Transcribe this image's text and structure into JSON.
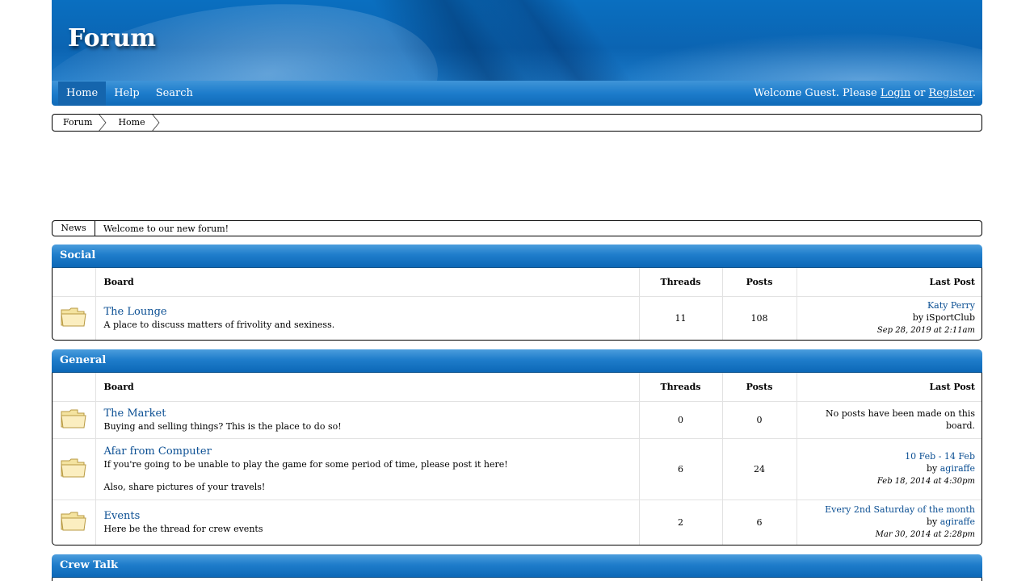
{
  "header": {
    "logo": "Forum"
  },
  "nav": {
    "tabs": [
      "Home",
      "Help",
      "Search"
    ],
    "welcome_prefix": "Welcome Guest. Please ",
    "login": "Login",
    "or": " or ",
    "register": "Register",
    "period": "."
  },
  "breadcrumb": [
    "Forum",
    "Home"
  ],
  "news": {
    "label": "News",
    "text": "Welcome to our new forum!"
  },
  "table_headers": {
    "board": "Board",
    "threads": "Threads",
    "posts": "Posts",
    "last_post": "Last Post"
  },
  "categories": [
    {
      "title": "Social",
      "boards": [
        {
          "name": "The Lounge",
          "desc": "A place to discuss matters of frivolity and sexiness.",
          "threads": "11",
          "posts": "108",
          "last_title": "Katy Perry",
          "last_by": "by iSportClub",
          "last_date": "Sep 28, 2019 at 2:11am"
        }
      ]
    },
    {
      "title": "General",
      "boards": [
        {
          "name": "The Market",
          "desc": "Buying and selling things? This is the place to do so!",
          "threads": "0",
          "posts": "0",
          "last_none": "No posts have been made on this board."
        },
        {
          "name": "Afar from Computer",
          "desc": "If you're going to be unable to play the game for some period of time, please post it here!",
          "desc2": "Also, share pictures of your travels!",
          "threads": "6",
          "posts": "24",
          "last_title": "10 Feb - 14 Feb",
          "last_by_prefix": "by ",
          "last_user": "agiraffe",
          "last_date": "Feb 18, 2014 at 4:30pm"
        },
        {
          "name": "Events",
          "desc": "Here be the thread for crew events",
          "threads": "2",
          "posts": "6",
          "last_title": "Every 2nd Saturday of the month",
          "last_by_prefix": "by ",
          "last_user": "agiraffe",
          "last_date": "Mar 30, 2014 at 2:28pm"
        }
      ]
    },
    {
      "title": "Crew Talk"
    }
  ]
}
